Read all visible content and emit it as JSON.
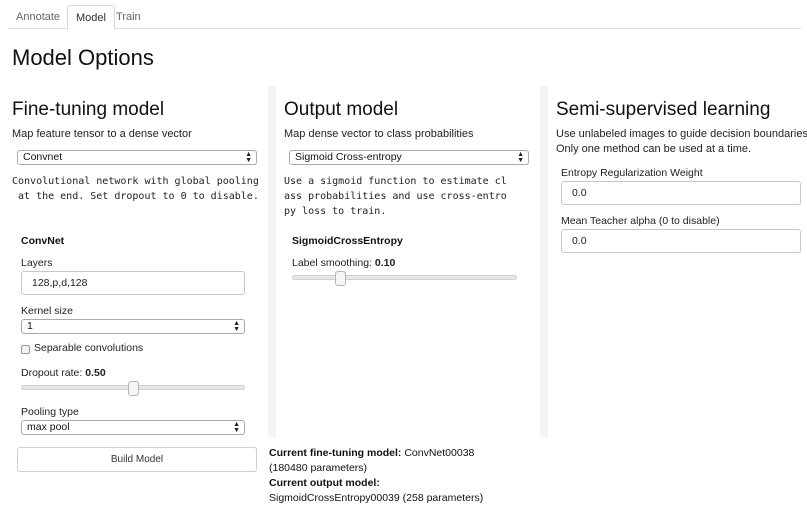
{
  "tabs": [
    "Annotate",
    "Model",
    "Train"
  ],
  "page_title": "Model Options",
  "finetune": {
    "title": "Fine-tuning model",
    "subtitle": "Map feature tensor to a dense vector",
    "select_value": "Convnet",
    "description": "Convolutional network with global pooling at the end. Set dropout to 0 to disable.",
    "section_title": "ConvNet",
    "layers_label": "Layers",
    "layers_value": "128,p,d,128",
    "kernel_label": "Kernel size",
    "kernel_value": "1",
    "separable_label": "Separable convolutions",
    "separable_checked": false,
    "dropout_label": "Dropout rate:",
    "dropout_value": "0.50",
    "dropout_fraction": 0.5,
    "pooling_label": "Pooling type",
    "pooling_value": "max pool",
    "build_button": "Build Model"
  },
  "output": {
    "title": "Output model",
    "subtitle": "Map dense vector to class probabilities",
    "select_value": "Sigmoid Cross-entropy",
    "description": "Use a sigmoid function to estimate class probabilities and use cross-entropy loss to train.",
    "section_title": "SigmoidCrossEntropy",
    "smoothing_label": "Label smoothing:",
    "smoothing_value": "0.10",
    "smoothing_fraction": 0.2
  },
  "semi": {
    "title": "Semi-supervised learning",
    "subtitle1": "Use unlabeled images to guide decision boundaries",
    "subtitle2": "Only one method can be used at a time.",
    "entropy_label": "Entropy Regularization Weight",
    "entropy_value": "0.0",
    "teacher_label": "Mean Teacher alpha (0 to disable)",
    "teacher_value": "0.0"
  },
  "status": {
    "finetune_label": "Current fine-tuning model:",
    "finetune_value": "ConvNet00038",
    "finetune_params": "(180480 parameters)",
    "output_label": "Current output model:",
    "output_value": "SigmoidCrossEntropy00039 (258 parameters)"
  }
}
